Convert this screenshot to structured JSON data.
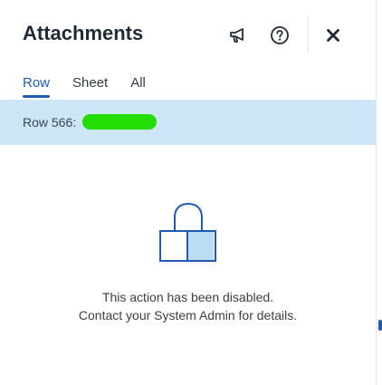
{
  "header": {
    "title": "Attachments",
    "icons": {
      "announce": "megaphone-icon",
      "help": "help-circle-icon",
      "close": "close-icon"
    }
  },
  "tabs": [
    {
      "label": "Row",
      "active": true
    },
    {
      "label": "Sheet",
      "active": false
    },
    {
      "label": "All",
      "active": false
    }
  ],
  "row_bar": {
    "label": "Row 566:"
  },
  "locked": {
    "icon": "lock-icon",
    "line1": "This action has been disabled.",
    "line2": "Contact your System Admin for details."
  },
  "colors": {
    "accent": "#1f5bb3",
    "row_bg": "#cde6f7",
    "redaction": "#22dd00"
  }
}
